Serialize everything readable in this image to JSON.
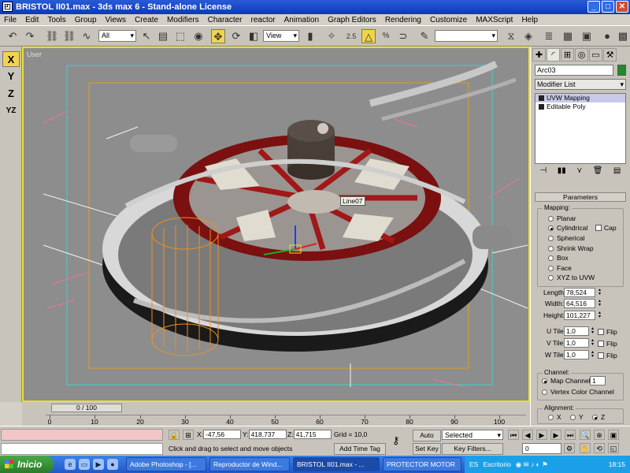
{
  "window": {
    "title": "BRISTOL II01.max - 3ds max 6 - Stand-alone License",
    "min": "_",
    "max": "□",
    "close": "✕"
  },
  "menu": [
    "File",
    "Edit",
    "Tools",
    "Group",
    "Views",
    "Create",
    "Modifiers",
    "Character",
    "reactor",
    "Animation",
    "Graph Editors",
    "Rendering",
    "Customize",
    "MAXScript",
    "Help"
  ],
  "toolbar": {
    "filter_dropdown": "All",
    "refcoord_dropdown": "View",
    "snap_label": "2.5",
    "named_sel": ""
  },
  "axes": [
    "X",
    "Y",
    "Z",
    "YZ"
  ],
  "viewport": {
    "label": "User",
    "object_label": "Line07"
  },
  "command_panel": {
    "object_name": "Arc03",
    "modifier_list": "Modifier List",
    "stack": [
      "UVW Mapping",
      "Editable Poly"
    ],
    "rollout_title": "Parameters",
    "mapping_group": "Mapping:",
    "mapping_options": [
      "Planar",
      "Cylindrical",
      "Spherical",
      "Shrink Wrap",
      "Box",
      "Face",
      "XYZ to UVW"
    ],
    "mapping_selected": "Cylindrical",
    "cap_label": "Cap",
    "length_label": "Length:",
    "length_value": "78,524",
    "width_label": "Width:",
    "width_value": "64,516",
    "height_label": "Height:",
    "height_value": "101,227",
    "utile_label": "U Tile:",
    "utile_value": "1,0",
    "vtile_label": "V Tile:",
    "vtile_value": "1,0",
    "wtile_label": "W Tile:",
    "wtile_value": "1,0",
    "flip_label": "Flip",
    "channel_group": "Channel:",
    "map_channel_label": "Map Channel:",
    "map_channel_value": "1",
    "vertex_color_label": "Vertex Color Channel",
    "alignment_group": "Alignment:",
    "align_x": "X",
    "align_y": "Y",
    "align_z": "Z"
  },
  "timeline": {
    "slider": "0 / 100",
    "ticks": [
      "0",
      "10",
      "20",
      "30",
      "40",
      "50",
      "60",
      "70",
      "80",
      "90",
      "100"
    ]
  },
  "status": {
    "prompt": "Click and drag to select and move objects",
    "x_label": "X:",
    "x_value": "-47,56",
    "y_label": "Y:",
    "y_value": "418,737",
    "z_label": "Z:",
    "z_value": "41,715",
    "grid": "Grid = 10,0",
    "add_time_tag": "Add Time Tag",
    "auto_key": "Auto Key",
    "set_key": "Set Key",
    "selected_dropdown": "Selected",
    "key_filters": "Key Filters...",
    "frame_value": "0"
  },
  "taskbar": {
    "start": "Inicio",
    "tasks": [
      "Adobe Photoshop - [...",
      "Reproductor de Wind...",
      "BRISTOL II01.max - ...",
      "PROTECTOR MOTOR"
    ],
    "lang": "ES",
    "desktop": "Escritorio",
    "clock": "18:15"
  }
}
